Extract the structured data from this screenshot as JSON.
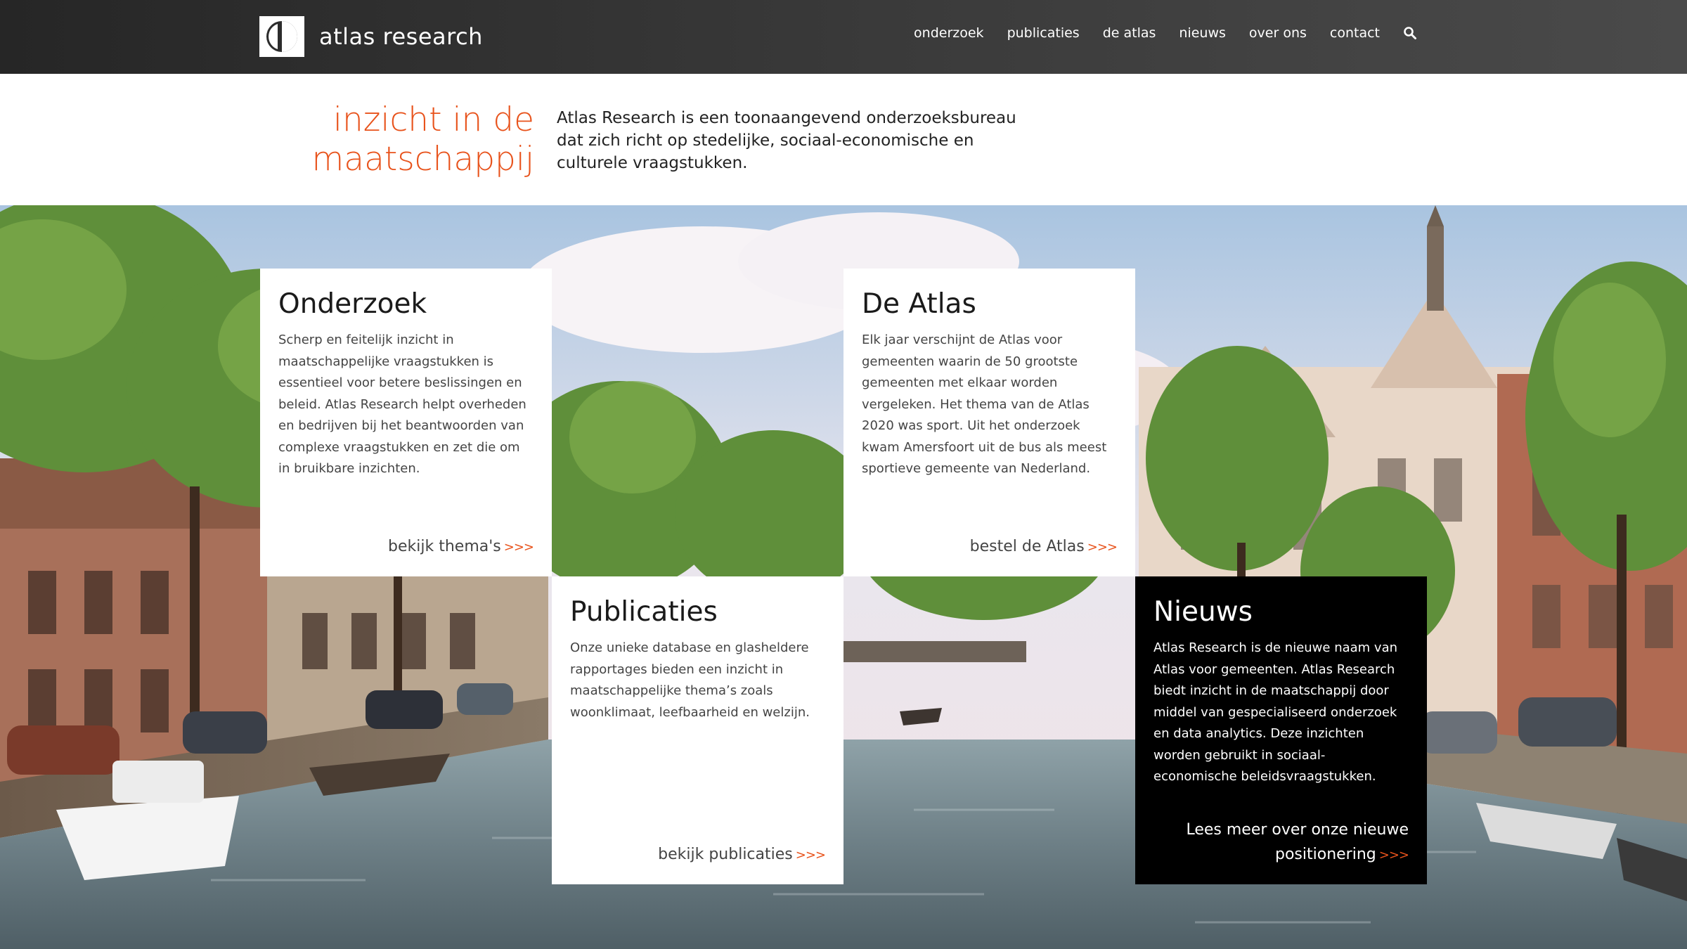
{
  "header": {
    "brand": "atlas research",
    "nav": [
      "onderzoek",
      "publicaties",
      "de atlas",
      "nieuws",
      "over ons",
      "contact"
    ],
    "search_icon": "search-icon"
  },
  "intro": {
    "tagline_line1": "inzicht in de",
    "tagline_line2": "maatschappij",
    "text": "Atlas Research is een toonaangevend onderzoeksbureau dat zich richt op stedelijke, sociaal-economische en culturele vraagstukken."
  },
  "cards": [
    {
      "title": "Onderzoek",
      "body": "Scherp en feitelijk inzicht in maatschappelijke vraagstukken is essentieel voor betere beslissingen en beleid. Atlas Research helpt overheden en bedrijven bij het beantwoorden van complexe vraagstukken en zet die om in bruikbare inzichten.",
      "link": "bekijk thema's",
      "arrows": ">>>"
    },
    {
      "title": "De Atlas",
      "body": "Elk jaar verschijnt de Atlas voor gemeenten waarin de 50 grootste gemeenten met elkaar worden vergeleken. Het thema van de Atlas 2020 was sport. Uit het onderzoek kwam Amersfoort uit de bus als meest sportieve gemeente van Nederland.",
      "link": "bestel de Atlas",
      "arrows": ">>>"
    },
    {
      "title": "Publicaties",
      "body": "Onze unieke database en glasheldere rapportages bieden een inzicht in maatschappelijke thema’s zoals woonklimaat, leefbaarheid en welzijn.",
      "link": "bekijk publicaties",
      "arrows": ">>>"
    },
    {
      "title": "Nieuws",
      "body": "Atlas Research is de nieuwe naam van Atlas voor gemeenten. Atlas Research biedt inzicht in de maatschappij door middel van gespecialiseerd onderzoek en data analytics. Deze inzichten worden gebruikt in sociaal-economische beleidsvraagstukken.",
      "link": "Lees meer over onze nieuwe positionering",
      "arrows": ">>>"
    }
  ],
  "colors": {
    "accent": "#e8531c",
    "header_bg": "#333333",
    "dark_card": "#000000"
  }
}
